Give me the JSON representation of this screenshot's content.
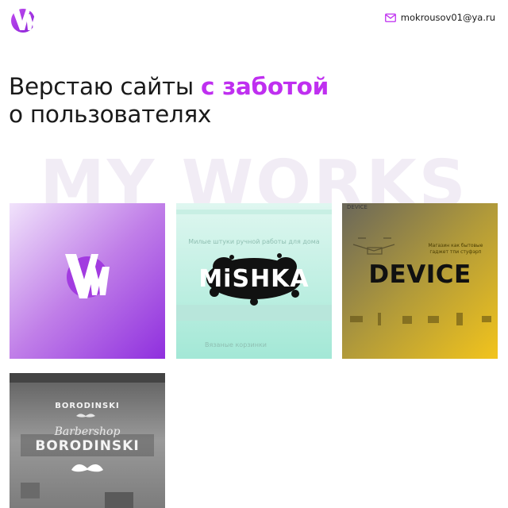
{
  "header": {
    "logo_alt": "VM",
    "email": "mokrousov01@ya.ru",
    "mail_icon": "mail-icon"
  },
  "hero": {
    "line1_start": "Верстаю сайты ",
    "line1_accent": "с заботой",
    "line2": "о пользователях"
  },
  "section": {
    "title": "MY WORKS"
  },
  "works": {
    "vm": {
      "logo_text": "VM"
    },
    "mishka": {
      "label": "MiSHKA",
      "top_text": "Милые штуки ручной работы для дома",
      "bottom_text": "Вязаные корзинки"
    },
    "device": {
      "label": "DEVICE",
      "top_text": "DEVICE",
      "sub_text": "Магазин как бытовые гаджет тпи стуфэрп"
    },
    "barbershop": {
      "brand_small": "BORODINSKI",
      "script": "Barbershop",
      "brand": "BORODINSKI"
    }
  },
  "colors": {
    "accent": "#bf2ff0",
    "vm_gradient_start": "#e8d4f6",
    "vm_gradient_end": "#9b3be0",
    "mishka_bg": "#a9ead9",
    "device_gradient_start": "#6e6b5a",
    "device_gradient_end": "#f1c21a",
    "barber_bg": "#8a8a8a"
  }
}
